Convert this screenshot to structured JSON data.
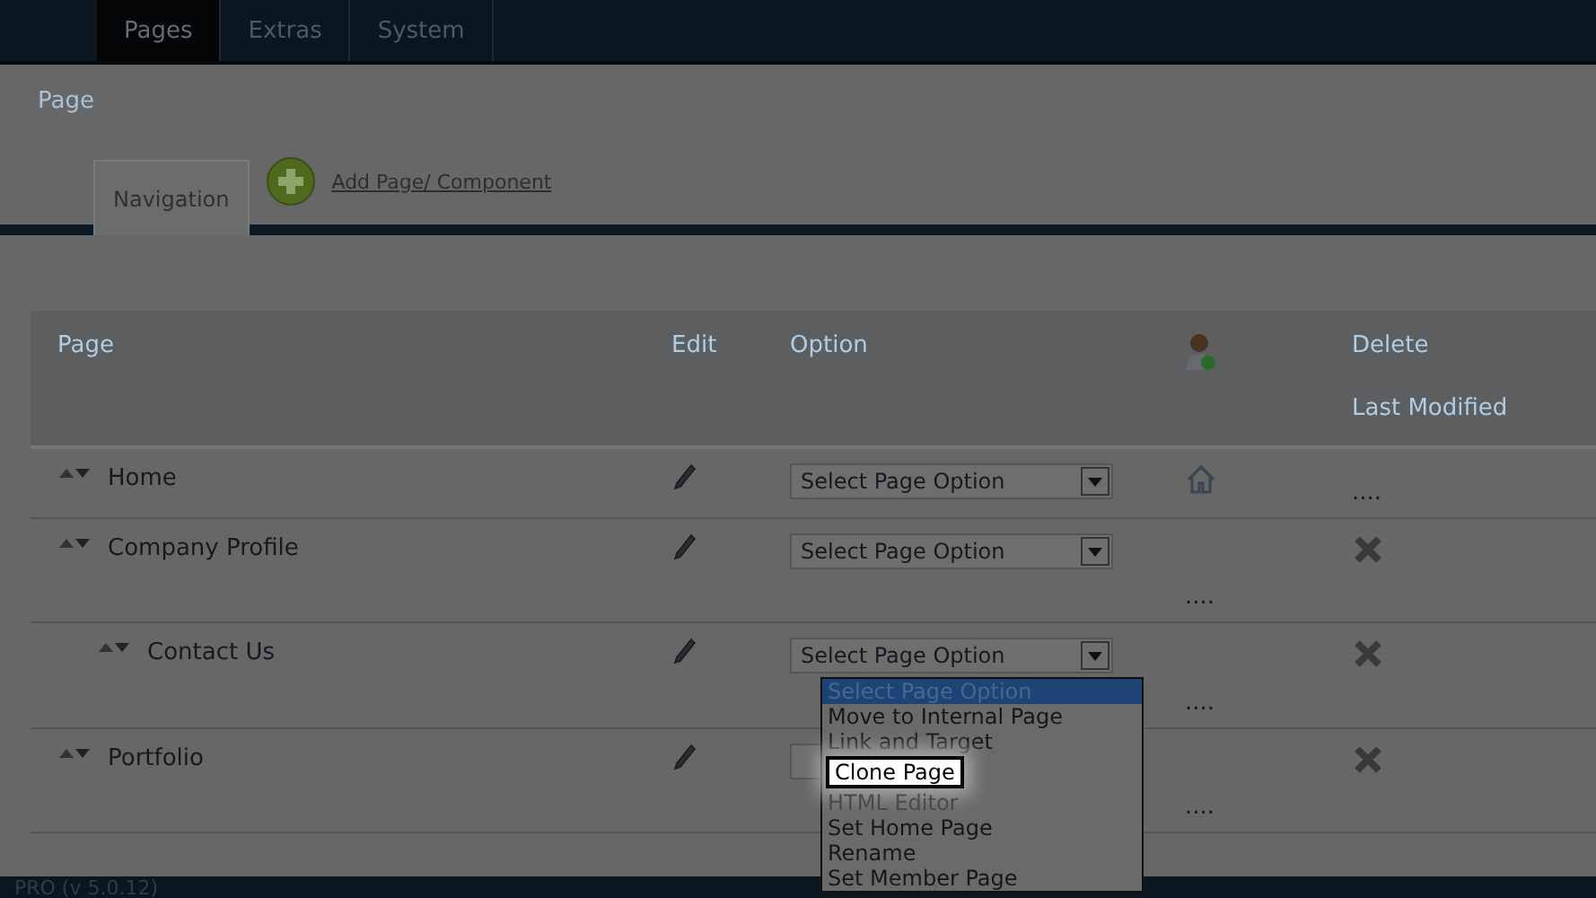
{
  "top_tabs": [
    {
      "label": "Pages",
      "selected": true
    },
    {
      "label": "Extras",
      "selected": false
    },
    {
      "label": "System",
      "selected": false
    }
  ],
  "section_title": "Page",
  "sub_tabs": [
    {
      "label": "Navigation",
      "selected": true
    }
  ],
  "add_link": "Add Page/ Component",
  "table": {
    "columns": [
      "Page",
      "Edit",
      "Option"
    ],
    "delete_heading": "Delete",
    "modified_heading": "Last Modified",
    "rows": [
      {
        "name": "Home",
        "select": "Select Page Option",
        "home": true,
        "deletable": false,
        "modified": "....",
        "open": false
      },
      {
        "name": "Company Profile",
        "select": "Select Page Option",
        "home": false,
        "deletable": true,
        "modified": "....",
        "open": false,
        "children": [
          {
            "name": "Contact Us",
            "select": "Select Page Option",
            "home": false,
            "deletable": true,
            "modified": "....",
            "open": true
          }
        ]
      },
      {
        "name": "Portfolio",
        "home": false,
        "deletable": true,
        "modified": "....",
        "open": false
      }
    ]
  },
  "dropdown_options": [
    {
      "label": "Select Page Option",
      "selected": true,
      "highlighted": false,
      "disabled": false
    },
    {
      "label": "Move to Internal Page",
      "selected": false,
      "highlighted": false,
      "disabled": false
    },
    {
      "label": "Link and Target",
      "selected": false,
      "highlighted": false,
      "disabled": false
    },
    {
      "label": "Clone Page",
      "selected": false,
      "highlighted": true,
      "disabled": false
    },
    {
      "label": "HTML Editor",
      "selected": false,
      "highlighted": false,
      "disabled": true
    },
    {
      "label": "Set Home Page",
      "selected": false,
      "highlighted": false,
      "disabled": false
    },
    {
      "label": "Rename",
      "selected": false,
      "highlighted": false,
      "disabled": false
    },
    {
      "label": "Set Member Page",
      "selected": false,
      "highlighted": false,
      "disabled": false
    }
  ],
  "status_bar": "PRO (v 5.0.12)"
}
